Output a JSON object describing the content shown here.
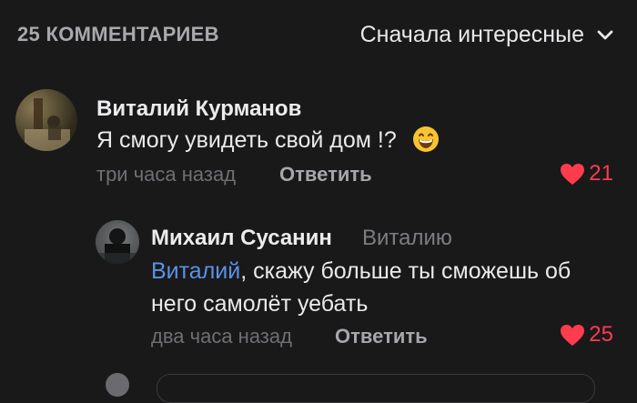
{
  "header": {
    "count_label": "25 КОММЕНТАРИЕВ",
    "sort_label": "Сначала интересные"
  },
  "comments": [
    {
      "author": "Виталий Курманов",
      "text": "Я смогу увидеть свой дом !?",
      "time": "три часа назад",
      "reply_label": "Ответить",
      "likes": "21"
    },
    {
      "author": "Михаил Сусанин",
      "reply_to": "Виталию",
      "mention": "Виталий",
      "text_line1": ", скажу больше ты сможешь об",
      "text_line2": "него самолёт уебать",
      "time": "два часа назад",
      "reply_label": "Ответить",
      "likes": "25"
    }
  ],
  "colors": {
    "background": "#19191a",
    "like": "#ff3b4e",
    "mention": "#5b92e5"
  }
}
